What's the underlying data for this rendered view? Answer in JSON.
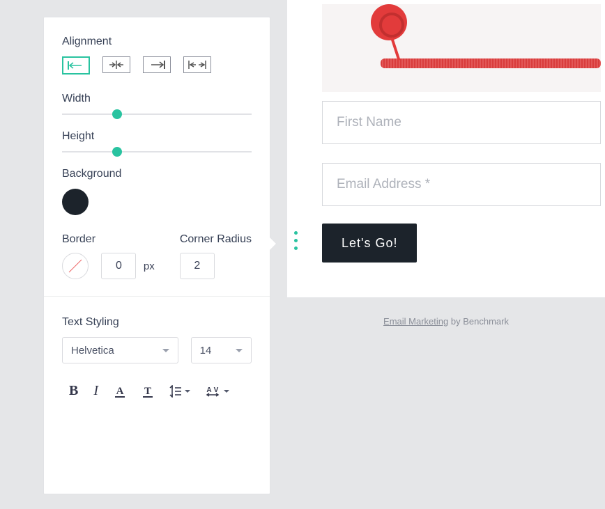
{
  "panel": {
    "alignment_label": "Alignment",
    "width_label": "Width",
    "height_label": "Height",
    "background_label": "Background",
    "background_color": "#1c232b",
    "border_label": "Border",
    "border_value": "0",
    "border_unit": "px",
    "corner_label": "Corner Radius",
    "corner_value": "2",
    "text_styling_label": "Text Styling",
    "font_family": "Helvetica",
    "font_size": "14",
    "slider_width_pct": 29,
    "slider_height_pct": 29
  },
  "form": {
    "first_name_placeholder": "First Name",
    "email_placeholder": "Email Address *",
    "submit_label": "Let's Go!"
  },
  "footer": {
    "link_text": "Email Marketing",
    "suffix": " by Benchmark"
  }
}
